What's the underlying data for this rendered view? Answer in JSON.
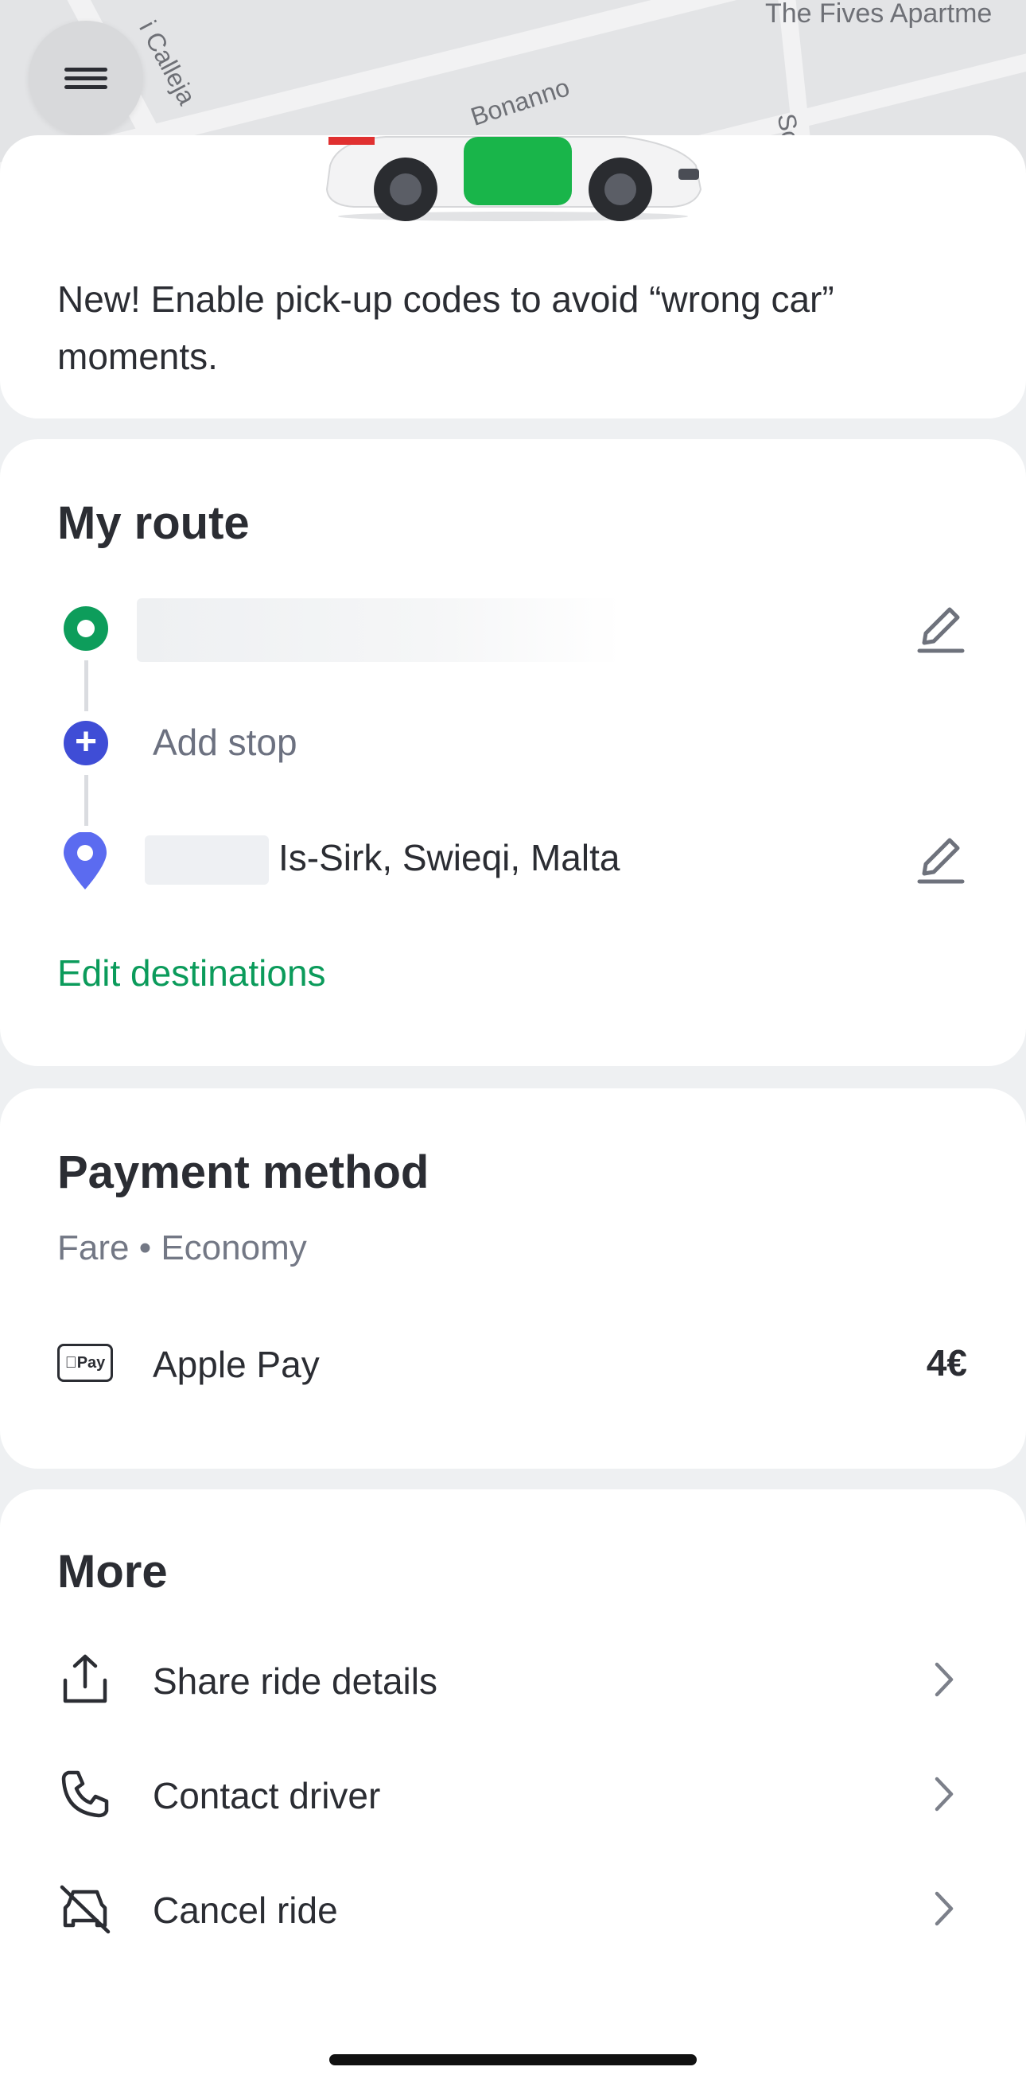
{
  "map": {
    "labels": [
      "i Calleja",
      "Bonanno",
      "The Fives Apartme",
      "So"
    ]
  },
  "menu": {
    "icon": "hamburger-menu-icon"
  },
  "promo": {
    "text": "New! Enable pick-up codes to avoid “wrong car” moments."
  },
  "route": {
    "title": "My route",
    "add_stop_label": "Add stop",
    "destination_label": "Is-Sirk, Swieqi, Malta",
    "edit_destinations_label": "Edit destinations"
  },
  "payment": {
    "title": "Payment method",
    "subtitle": "Fare • Economy",
    "method_label": "Apple Pay",
    "method_badge": "Pay",
    "price": "4€"
  },
  "more": {
    "title": "More",
    "items": [
      {
        "label": "Share ride details",
        "icon": "share-icon"
      },
      {
        "label": "Contact driver",
        "icon": "phone-icon"
      },
      {
        "label": "Cancel ride",
        "icon": "cancel-car-icon"
      }
    ]
  },
  "colors": {
    "accent_green": "#0b9b5b",
    "stop_blue": "#3f4dd6",
    "destination_blue": "#5b6bf0"
  }
}
